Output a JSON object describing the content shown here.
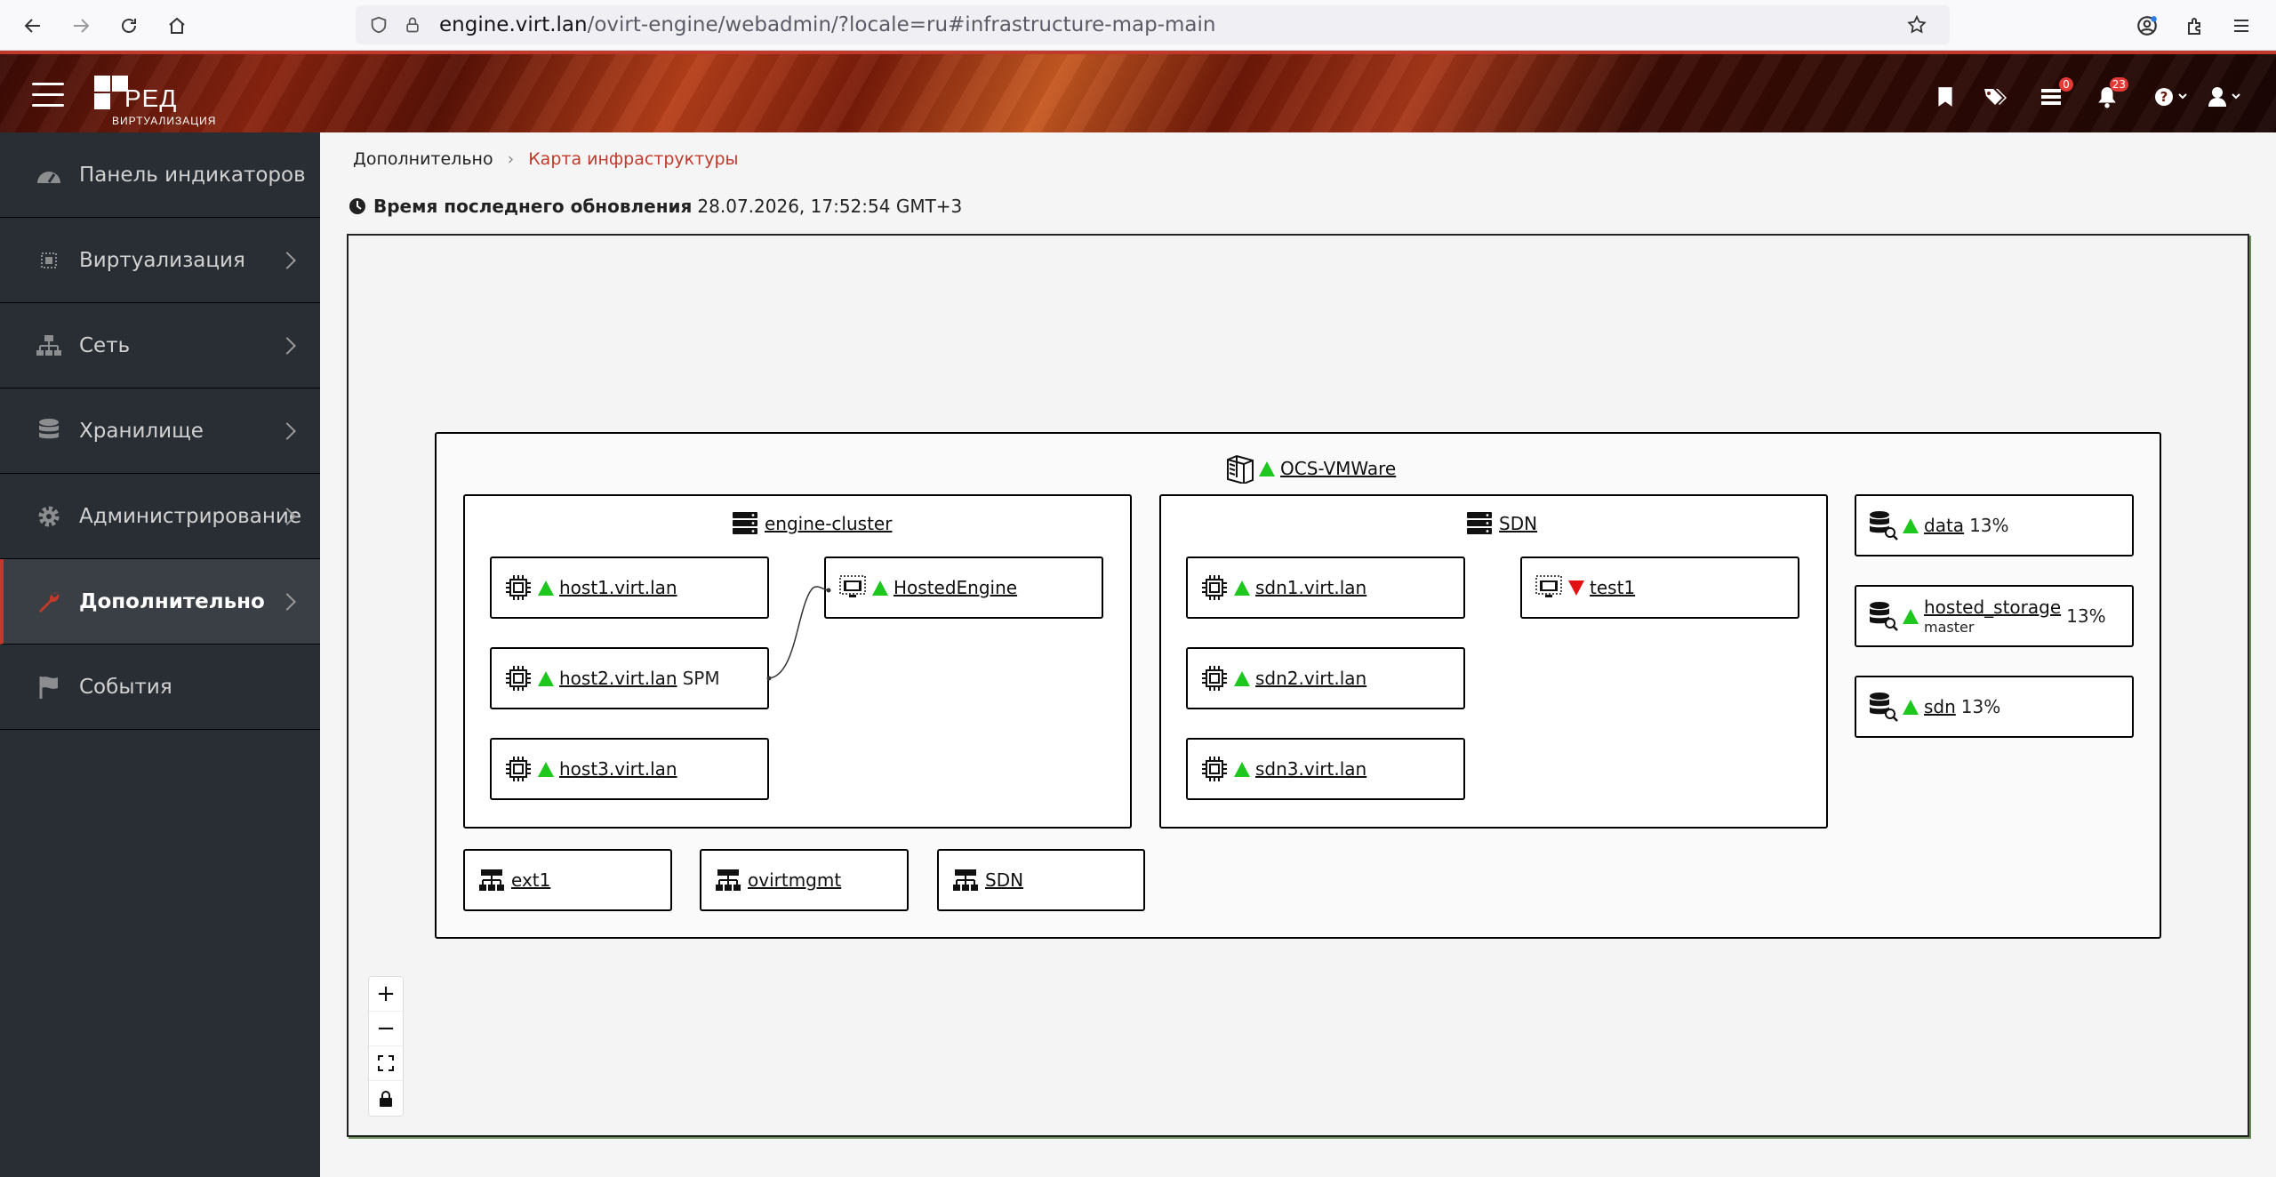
{
  "browser": {
    "url_host": "engine.virt.lan",
    "url_path": "/ovirt-engine/webadmin/?locale=ru#infrastructure-map-main"
  },
  "header": {
    "logo_text": "РЕД",
    "logo_sub": "ВИРТУАЛИЗАЦИЯ",
    "tasks_count": "0",
    "alerts_count": "23"
  },
  "sidebar": {
    "items": [
      {
        "label": "Панель индикаторов"
      },
      {
        "label": "Виртуализация"
      },
      {
        "label": "Сеть"
      },
      {
        "label": "Хранилище"
      },
      {
        "label": "Администрирование"
      },
      {
        "label": "Дополнительно"
      },
      {
        "label": "События"
      }
    ]
  },
  "breadcrumb": {
    "parent": "Дополнительно",
    "current": "Карта инфраструктуры"
  },
  "update": {
    "label": "Время последнего обновления",
    "value": "28.07.2026, 17:52:54 GMT+3"
  },
  "map": {
    "datacenter": {
      "name": "OCS-VMWare",
      "status": "up"
    },
    "clusters": [
      {
        "name": "engine-cluster",
        "hosts": [
          {
            "name": "host1.virt.lan",
            "status": "up",
            "extra": ""
          },
          {
            "name": "host2.virt.lan",
            "status": "up",
            "extra": "SPM"
          },
          {
            "name": "host3.virt.lan",
            "status": "up",
            "extra": ""
          }
        ],
        "vms": [
          {
            "name": "HostedEngine",
            "status": "up"
          }
        ]
      },
      {
        "name": "SDN",
        "hosts": [
          {
            "name": "sdn1.virt.lan",
            "status": "up"
          },
          {
            "name": "sdn2.virt.lan",
            "status": "up"
          },
          {
            "name": "sdn3.virt.lan",
            "status": "up"
          }
        ],
        "vms": [
          {
            "name": "test1",
            "status": "down"
          }
        ]
      }
    ],
    "storage": [
      {
        "name": "data",
        "usage": "13%",
        "role": ""
      },
      {
        "name": "hosted_storage",
        "usage": "13%",
        "role": "master"
      },
      {
        "name": "sdn",
        "usage": "13%",
        "role": ""
      }
    ],
    "networks": [
      {
        "name": "ext1"
      },
      {
        "name": "ovirtmgmt"
      },
      {
        "name": "SDN"
      }
    ],
    "zoom_controls": [
      "+",
      "−"
    ]
  },
  "colors": {
    "status_up": "#1ec71e",
    "status_down": "#e21212",
    "accent": "#c0392b",
    "sidebar_bg": "#292e34"
  }
}
